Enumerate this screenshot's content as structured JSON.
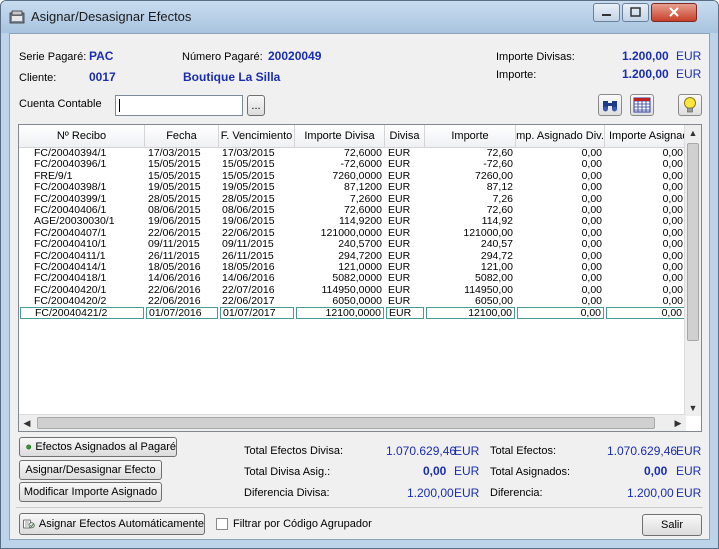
{
  "window": {
    "title": "Asignar/Desasignar Efectos"
  },
  "header": {
    "serie_label": "Serie Pagaré:",
    "serie_value": "PAC",
    "numero_label": "Número Pagaré:",
    "numero_value": "20020049",
    "cliente_label": "Cliente:",
    "cliente_code": "0017",
    "cliente_name": "Boutique La Silla",
    "importe_divisas_label": "Importe Divisas:",
    "importe_divisas_value": "1.200,00",
    "importe_divisas_cur": "EUR",
    "importe_label": "Importe:",
    "importe_value": "1.200,00",
    "importe_cur": "EUR",
    "cuenta_label": "Cuenta Contable",
    "cuenta_value": "",
    "browse_label": "..."
  },
  "grid": {
    "columns": [
      "Nº Recibo",
      "Fecha",
      "F. Vencimiento",
      "Importe Divisa",
      "Divisa",
      "Importe",
      "mp. Asignado Div.",
      "Importe Asignad"
    ],
    "rows": [
      [
        "FC/20040394/1",
        "17/03/2015",
        "17/03/2015",
        "72,6000",
        "EUR",
        "72,60",
        "0,00",
        "0,00"
      ],
      [
        "FC/20040396/1",
        "15/05/2015",
        "15/05/2015",
        "-72,6000",
        "EUR",
        "-72,60",
        "0,00",
        "0,00"
      ],
      [
        "FRE/9/1",
        "15/05/2015",
        "15/05/2015",
        "7260,0000",
        "EUR",
        "7260,00",
        "0,00",
        "0,00"
      ],
      [
        "FC/20040398/1",
        "19/05/2015",
        "19/05/2015",
        "87,1200",
        "EUR",
        "87,12",
        "0,00",
        "0,00"
      ],
      [
        "FC/20040399/1",
        "28/05/2015",
        "28/05/2015",
        "7,2600",
        "EUR",
        "7,26",
        "0,00",
        "0,00"
      ],
      [
        "FC/20040406/1",
        "08/06/2015",
        "08/06/2015",
        "72,6000",
        "EUR",
        "72,60",
        "0,00",
        "0,00"
      ],
      [
        "AGE/20030030/1",
        "19/06/2015",
        "19/06/2015",
        "114,9200",
        "EUR",
        "114,92",
        "0,00",
        "0,00"
      ],
      [
        "FC/20040407/1",
        "22/06/2015",
        "22/06/2015",
        "121000,0000",
        "EUR",
        "121000,00",
        "0,00",
        "0,00"
      ],
      [
        "FC/20040410/1",
        "09/11/2015",
        "09/11/2015",
        "240,5700",
        "EUR",
        "240,57",
        "0,00",
        "0,00"
      ],
      [
        "FC/20040411/1",
        "26/11/2015",
        "26/11/2015",
        "294,7200",
        "EUR",
        "294,72",
        "0,00",
        "0,00"
      ],
      [
        "FC/20040414/1",
        "18/05/2016",
        "18/05/2016",
        "121,0000",
        "EUR",
        "121,00",
        "0,00",
        "0,00"
      ],
      [
        "FC/20040418/1",
        "14/06/2016",
        "14/06/2016",
        "5082,0000",
        "EUR",
        "5082,00",
        "0,00",
        "0,00"
      ],
      [
        "FC/20040420/1",
        "22/06/2016",
        "22/07/2016",
        "114950,0000",
        "EUR",
        "114950,00",
        "0,00",
        "0,00"
      ],
      [
        "FC/20040420/2",
        "22/06/2016",
        "22/06/2017",
        "6050,0000",
        "EUR",
        "6050,00",
        "0,00",
        "0,00"
      ],
      [
        "FC/20040421/2",
        "01/07/2016",
        "01/07/2017",
        "12100,0000",
        "EUR",
        "12100,00",
        "0,00",
        "0,00"
      ]
    ]
  },
  "buttons": {
    "efectos_asignados": "Efectos Asignados al Pagaré",
    "asignar_desasignar": "Asignar/Desasignar Efecto",
    "modificar_importe": "Modificar Importe Asignado",
    "asignar_auto": "Asignar Efectos Automáticamente",
    "filtrar": "Filtrar por Código Agrupador",
    "salir": "Salir"
  },
  "totals": {
    "total_efectos_divisa_label": "Total Efectos Divisa:",
    "total_efectos_divisa_value": "1.070.629,46",
    "total_efectos_divisa_cur": "EUR",
    "total_divisa_asig_label": "Total Divisa Asig.:",
    "total_divisa_asig_value": "0,00",
    "total_divisa_asig_cur": "EUR",
    "diferencia_divisa_label": "Diferencia Divisa:",
    "diferencia_divisa_value": "1.200,00",
    "diferencia_divisa_cur": "EUR",
    "total_efectos_label": "Total Efectos:",
    "total_efectos_value": "1.070.629,46",
    "total_efectos_cur": "EUR",
    "total_asignados_label": "Total Asignados:",
    "total_asignados_value": "0,00",
    "total_asignados_cur": "EUR",
    "diferencia_label": "Diferencia:",
    "diferencia_value": "1.200,00",
    "diferencia_cur": "EUR"
  }
}
